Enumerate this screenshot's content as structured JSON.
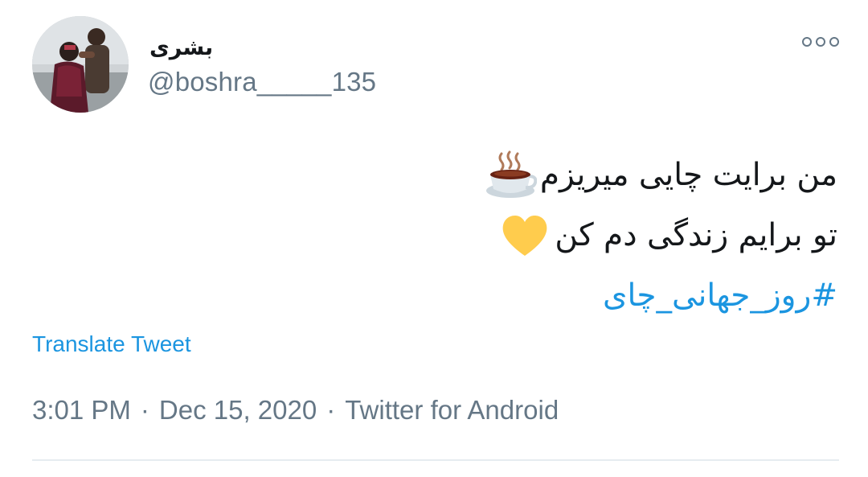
{
  "tweet": {
    "author": {
      "display_name": "بشری",
      "handle": "@boshra_____135"
    },
    "text_lines": [
      "من برایت چایی میریزم",
      "تو برایم زندگی دم کن"
    ],
    "emojis": [
      "hot-beverage",
      "yellow-heart"
    ],
    "hashtag": "#روز_جهانی_چای",
    "translate_label": "Translate Tweet",
    "time": "3:01 PM",
    "date": "Dec 15, 2020",
    "separator": "·",
    "source": "Twitter for Android"
  },
  "colors": {
    "link": "#1b95e0",
    "secondary_text": "#657786",
    "primary_text": "#14171a",
    "divider": "#e6ecf0",
    "heart": "#ffcc4d"
  }
}
